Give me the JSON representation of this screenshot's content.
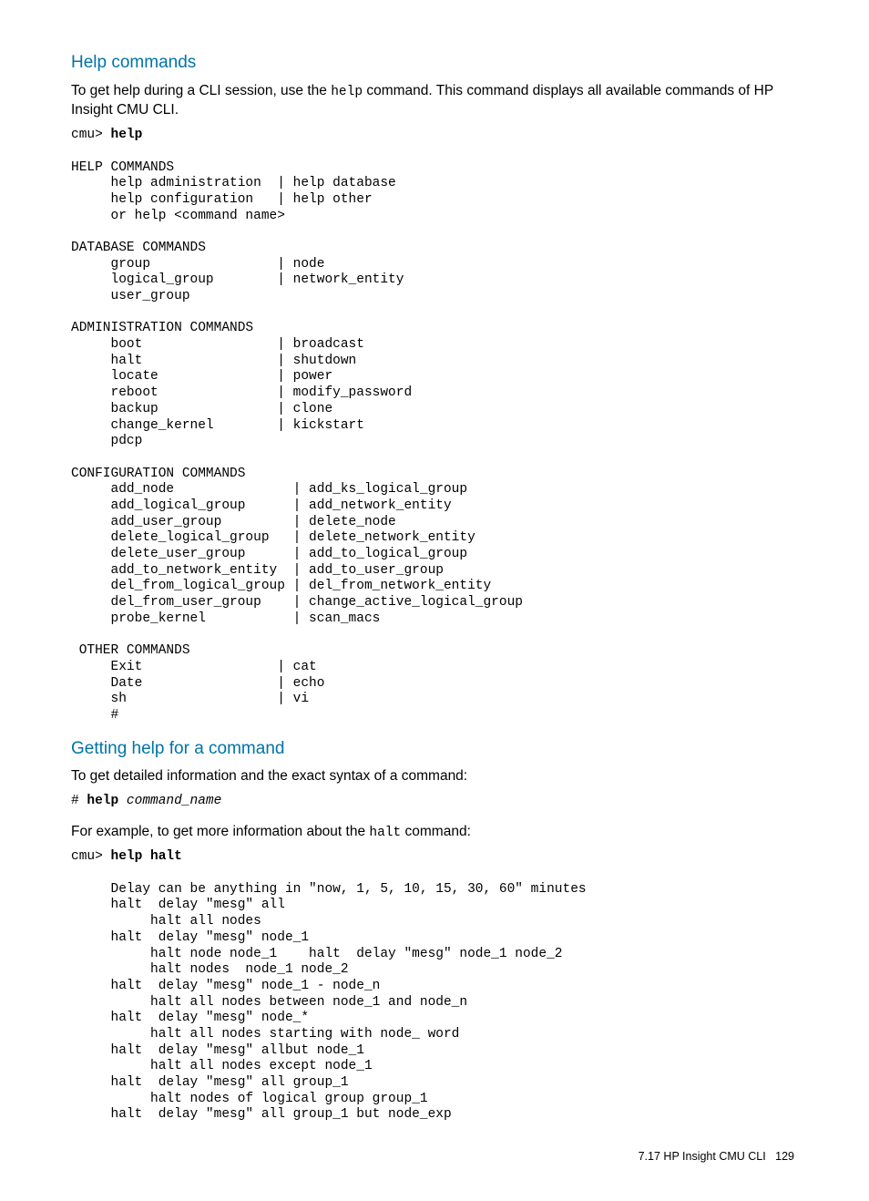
{
  "section1": {
    "heading": "Help commands",
    "intro_before": "To get help during a CLI session, use the ",
    "intro_code": "help",
    "intro_after": " command. This command displays all available commands of HP Insight CMU CLI.",
    "prompt": "cmu> ",
    "prompt_cmd": "help",
    "block": "HELP COMMANDS\n     help administration  | help database\n     help configuration   | help other\n     or help <command name>\n\nDATABASE COMMANDS\n     group                | node\n     logical_group        | network_entity\n     user_group\n\nADMINISTRATION COMMANDS\n     boot                 | broadcast\n     halt                 | shutdown\n     locate               | power\n     reboot               | modify_password\n     backup               | clone\n     change_kernel        | kickstart\n     pdcp\n\nCONFIGURATION COMMANDS\n     add_node               | add_ks_logical_group\n     add_logical_group      | add_network_entity\n     add_user_group         | delete_node\n     delete_logical_group   | delete_network_entity\n     delete_user_group      | add_to_logical_group\n     add_to_network_entity  | add_to_user_group\n     del_from_logical_group | del_from_network_entity\n     del_from_user_group    | change_active_logical_group\n     probe_kernel           | scan_macs\n\n OTHER COMMANDS\n     Exit                 | cat\n     Date                 | echo\n     sh                   | vi\n     #"
  },
  "section2": {
    "heading": "Getting help for a command",
    "intro": "To get detailed information and the exact syntax of a command:",
    "syntax_prompt": "# ",
    "syntax_cmd": "help ",
    "syntax_arg": "command_name",
    "example_before": "For example, to get more information about the ",
    "example_code": "halt",
    "example_after": " command:",
    "prompt": "cmu> ",
    "prompt_cmd": "help halt",
    "block": "     Delay can be anything in \"now, 1, 5, 10, 15, 30, 60\" minutes\n     halt  delay \"mesg\" all\n          halt all nodes\n     halt  delay \"mesg\" node_1\n          halt node node_1    halt  delay \"mesg\" node_1 node_2\n          halt nodes  node_1 node_2\n     halt  delay \"mesg\" node_1 - node_n\n          halt all nodes between node_1 and node_n\n     halt  delay \"mesg\" node_*\n          halt all nodes starting with node_ word\n     halt  delay \"mesg\" allbut node_1\n          halt all nodes except node_1\n     halt  delay \"mesg\" all group_1\n          halt nodes of logical group group_1\n     halt  delay \"mesg\" all group_1 but node_exp"
  },
  "footer": {
    "section": "7.17 HP Insight CMU CLI",
    "page": "129"
  }
}
